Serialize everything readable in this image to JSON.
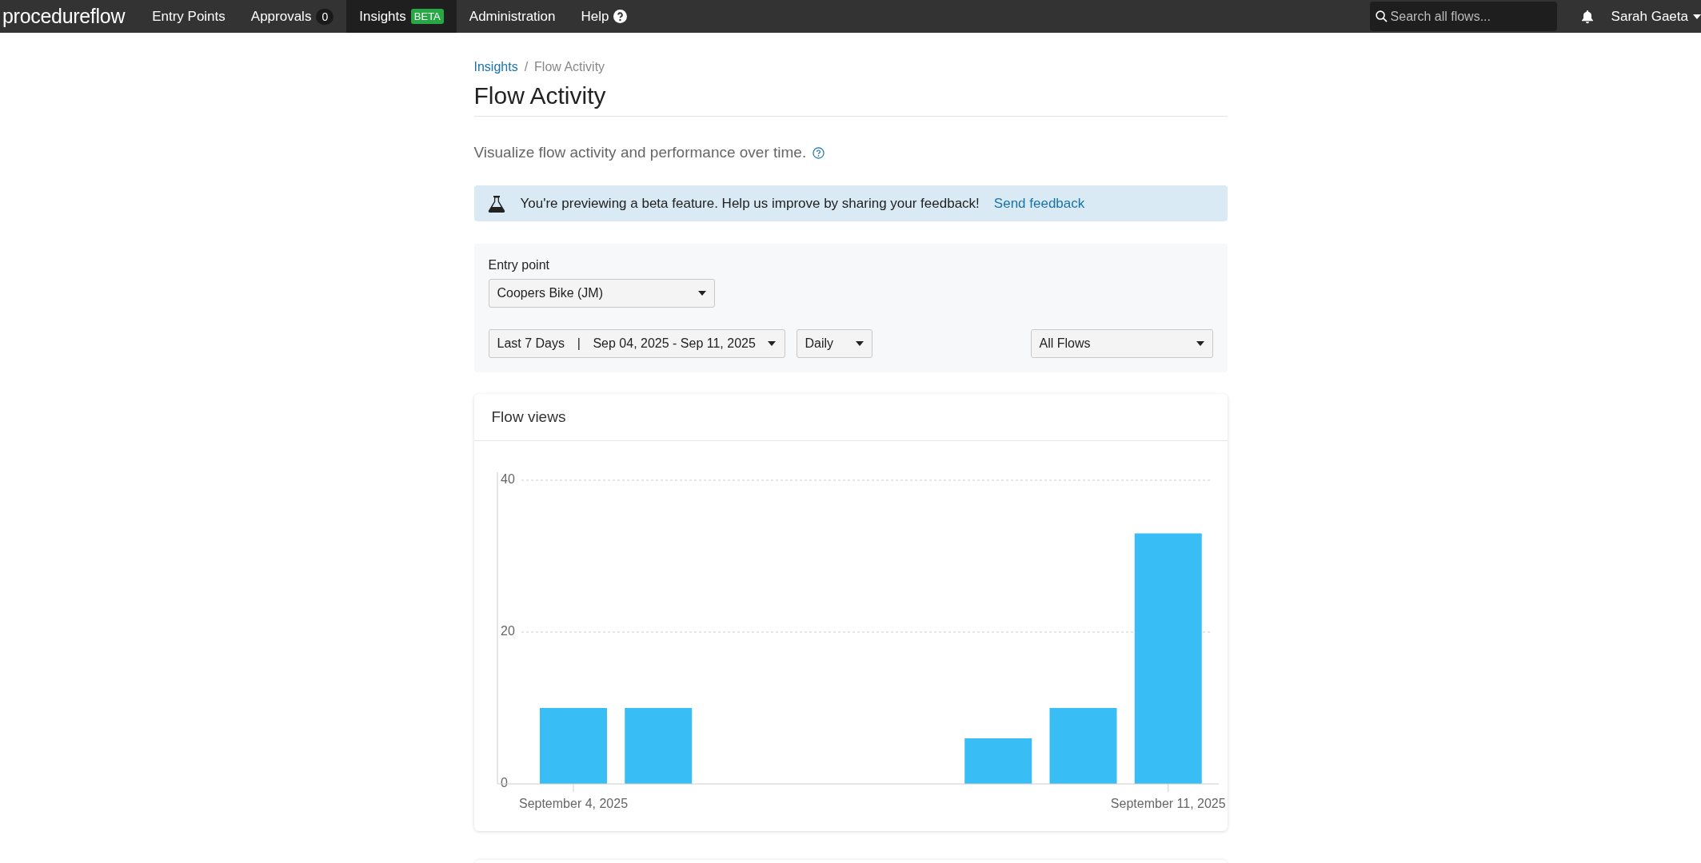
{
  "navbar": {
    "logo": "procedureflow",
    "items": [
      {
        "label": "Entry Points",
        "kind": "plain",
        "selected": false
      },
      {
        "label": "Approvals",
        "kind": "count",
        "badge": "0",
        "selected": false
      },
      {
        "label": "Insights",
        "kind": "tag",
        "badge": "BETA",
        "selected": true
      },
      {
        "label": "Administration",
        "kind": "plain",
        "selected": false
      },
      {
        "label": "Help",
        "kind": "help",
        "selected": false
      }
    ],
    "search": {
      "placeholder": "Search all flows..."
    },
    "user": "Sarah Gaeta"
  },
  "breadcrumb": [
    {
      "label": "Insights",
      "kind": "link"
    },
    {
      "label": "/",
      "kind": "separator"
    },
    {
      "label": "Flow Activity",
      "kind": "current"
    }
  ],
  "title": "Flow Activity",
  "description": "Visualize flow activity and performance over time.",
  "banner": {
    "text": "You're previewing a beta feature. Help us improve by sharing your feedback!",
    "link": "Send feedback"
  },
  "filters": {
    "entry_point_label": "Entry point",
    "entry_point": "Coopers Bike (JM)",
    "range_preset": "Last 7 Days",
    "range_separator": "|",
    "range_dates": "Sep 04, 2025 - Sep 11, 2025",
    "interval": "Daily",
    "flows": "All Flows"
  },
  "chart_card": {
    "title": "Flow views",
    "chart_data": {
      "type": "bar",
      "categories": [
        "September 4, 2025",
        null,
        null,
        null,
        null,
        null,
        null,
        "September 11, 2025"
      ],
      "values": [
        10,
        10,
        0,
        0,
        0,
        6,
        10,
        33
      ],
      "ylim": [
        0,
        40
      ],
      "yticks": [
        0,
        20,
        40
      ]
    }
  }
}
